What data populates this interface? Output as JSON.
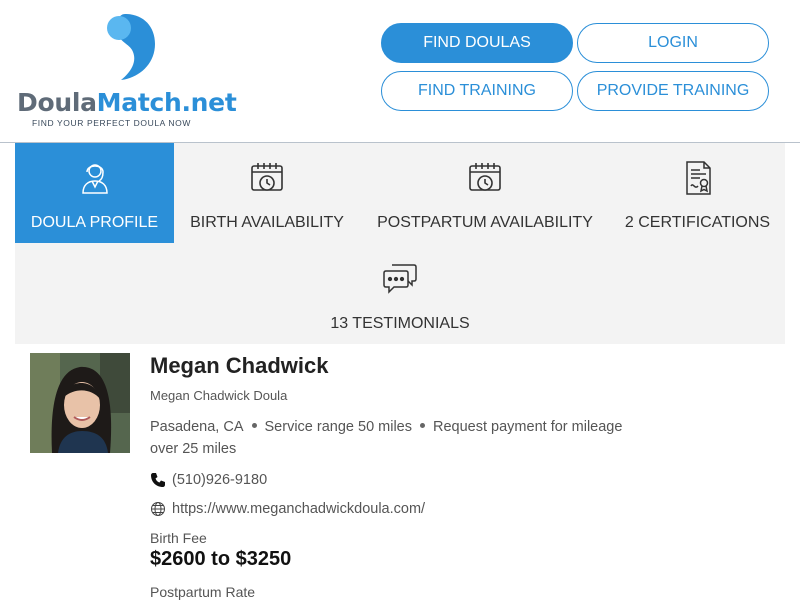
{
  "logo": {
    "word_part1": "Doula",
    "word_part2": "Match.net",
    "tagline": "FIND YOUR PERFECT DOULA NOW",
    "colors": {
      "primary": "#2b8fd8",
      "light": "#5ab7f0",
      "gray": "#5f6b78"
    }
  },
  "nav": {
    "find_doulas": "FIND DOULAS",
    "login": "LOGIN",
    "find_training": "FIND TRAINING",
    "provide_training": "PROVIDE TRAINING"
  },
  "tabs": [
    {
      "label": "DOULA PROFILE",
      "icon": "doula-profile-icon",
      "active": true
    },
    {
      "label": "BIRTH AVAILABILITY",
      "icon": "calendar-clock-icon",
      "active": false
    },
    {
      "label": "POSTPARTUM AVAILABILITY",
      "icon": "calendar-clock-icon",
      "active": false
    },
    {
      "label": "2 CERTIFICATIONS",
      "icon": "certificate-icon",
      "active": false
    },
    {
      "label": "13 TESTIMONIALS",
      "icon": "chat-bubbles-icon",
      "active": false
    }
  ],
  "profile": {
    "name": "Megan Chadwick",
    "business": "Megan Chadwick Doula",
    "location": "Pasadena, CA",
    "service_range": "Service range 50 miles",
    "mileage": "Request payment for mileage over 25 miles",
    "phone": "(510)926-9180",
    "website": "https://www.meganchadwickdoula.com/",
    "birth_fee_label": "Birth Fee",
    "birth_fee": "$2600 to $3250",
    "postpartum_label": "Postpartum Rate"
  }
}
